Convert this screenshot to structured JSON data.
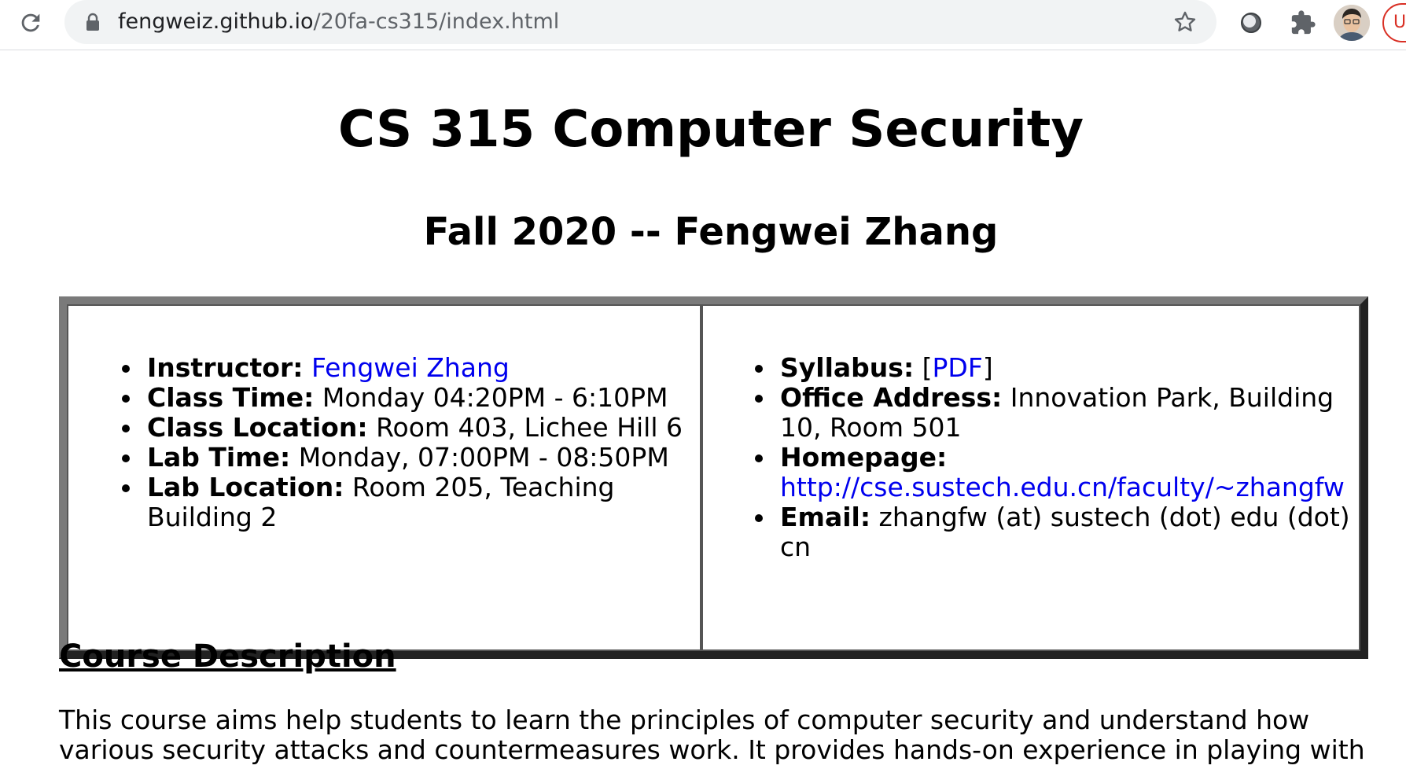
{
  "browser": {
    "url_host": "fengweiz.github.io",
    "url_path": "/20fa-cs315/index.html",
    "update_button_label": "U"
  },
  "page": {
    "title": "CS 315 Computer Security",
    "subtitle": "Fall 2020 -- Fengwei Zhang",
    "left_items": [
      {
        "label": "Instructor:",
        "link": "Fengwei Zhang"
      },
      {
        "label": "Class Time:",
        "value": "Monday 04:20PM - 6:10PM"
      },
      {
        "label": "Class Location:",
        "value": "Room 403, Lichee Hill 6"
      },
      {
        "label": "Lab Time:",
        "value": "Monday, 07:00PM - 08:50PM"
      },
      {
        "label": "Lab Location:",
        "value": "Room 205, Teaching Building 2"
      }
    ],
    "right_items": [
      {
        "label": "Syllabus:",
        "bracket_open": "[",
        "link": "PDF",
        "bracket_close": "]"
      },
      {
        "label": "Office Address:",
        "value": "Innovation Park, Building 10, Room 501"
      },
      {
        "label": "Homepage:",
        "link": "http://cse.sustech.edu.cn/faculty/~zhangfw"
      },
      {
        "label": "Email:",
        "value": "zhangfw (at) sustech (dot) edu (dot) cn"
      }
    ],
    "section_heading": "Course Description",
    "description": "This course aims help students to learn the principles of computer security and understand how various security attacks and countermeasures work. It provides hands-on experience in playing with"
  },
  "colors": {
    "link": "#0000ee",
    "chrome_bg": "#f1f3f4",
    "update_red": "#d93025"
  }
}
